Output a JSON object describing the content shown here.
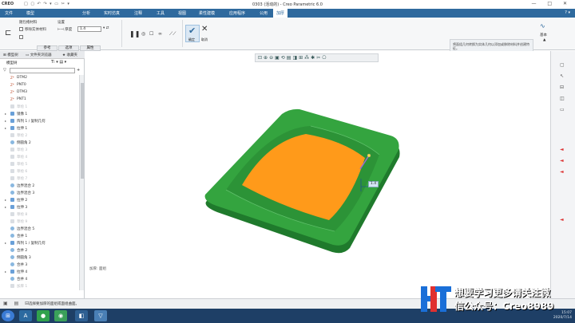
{
  "window": {
    "logo": "CREO",
    "title": "0303 (活动的) - Creo Parametric 6.0",
    "controls": [
      "—",
      "□",
      "✕"
    ]
  },
  "menu": {
    "tabs": [
      "文件",
      "模型",
      "分析",
      "实时仿真",
      "注释",
      "工具",
      "视图",
      "柔性建模",
      "应用程序",
      "公用",
      "加厚"
    ],
    "active": "加厚",
    "file_tab": "文件"
  },
  "ribbon": {
    "group_label": "随包络材料",
    "remove_material": "移除实体材料",
    "thickness_label": "厚度",
    "thickness_value": "1.4",
    "settings_label": "设置",
    "ok_label": "确定",
    "cancel_label": "取消",
    "subtabs": [
      "参考",
      "选项",
      "属性"
    ],
    "message": "将面组几何转换为实体几何以添加或移除材料并创建特征。",
    "message_link": "了解更多...",
    "basic_label": "基本"
  },
  "tree": {
    "tabs": [
      "模型树",
      "文件夹浏览器",
      "收藏夹"
    ],
    "toolbar_label": "模型树",
    "items": [
      {
        "label": "DTM2",
        "kind": "datum",
        "dim": false,
        "expandable": false
      },
      {
        "label": "PNT0",
        "kind": "datum",
        "dim": false,
        "expandable": false
      },
      {
        "label": "DTM3",
        "kind": "datum",
        "dim": false,
        "expandable": false
      },
      {
        "label": "PNT1",
        "kind": "datum",
        "dim": false,
        "expandable": false
      },
      {
        "label": "草绘 1",
        "kind": "dim",
        "dim": true,
        "expandable": false
      },
      {
        "label": "镜像 1",
        "kind": "feat",
        "dim": false,
        "expandable": true
      },
      {
        "label": "阵列 1 / 复制几何",
        "kind": "feat",
        "dim": false,
        "expandable": true
      },
      {
        "label": "拉伸 1",
        "kind": "feat",
        "dim": false,
        "expandable": true
      },
      {
        "label": "草绘 2",
        "kind": "dim",
        "dim": true,
        "expandable": false
      },
      {
        "label": "倒圆角 2",
        "kind": "round",
        "dim": false,
        "expandable": false
      },
      {
        "label": "草绘 3",
        "kind": "dim",
        "dim": true,
        "expandable": false
      },
      {
        "label": "草绘 4",
        "kind": "dim",
        "dim": true,
        "expandable": false
      },
      {
        "label": "草绘 5",
        "kind": "dim",
        "dim": true,
        "expandable": false
      },
      {
        "label": "草绘 6",
        "kind": "dim",
        "dim": true,
        "expandable": false
      },
      {
        "label": "草绘 7",
        "kind": "dim",
        "dim": true,
        "expandable": false
      },
      {
        "label": "边界混合 2",
        "kind": "round",
        "dim": false,
        "expandable": false
      },
      {
        "label": "边界混合 3",
        "kind": "round",
        "dim": false,
        "expandable": false
      },
      {
        "label": "拉伸 2",
        "kind": "feat",
        "dim": false,
        "expandable": true
      },
      {
        "label": "拉伸 3",
        "kind": "feat",
        "dim": false,
        "expandable": true
      },
      {
        "label": "草绘 8",
        "kind": "dim",
        "dim": true,
        "expandable": false
      },
      {
        "label": "草绘 9",
        "kind": "dim",
        "dim": true,
        "expandable": false
      },
      {
        "label": "边界混合 5",
        "kind": "round",
        "dim": false,
        "expandable": false
      },
      {
        "label": "合并 1",
        "kind": "round",
        "dim": false,
        "expandable": false
      },
      {
        "label": "阵列 1 / 复制几何",
        "kind": "feat",
        "dim": false,
        "expandable": true
      },
      {
        "label": "合并 2",
        "kind": "round",
        "dim": false,
        "expandable": false
      },
      {
        "label": "倒圆角 3",
        "kind": "round",
        "dim": false,
        "expandable": false
      },
      {
        "label": "合并 3",
        "kind": "round",
        "dim": false,
        "expandable": false
      },
      {
        "label": "拉伸 4",
        "kind": "feat",
        "dim": false,
        "expandable": true
      },
      {
        "label": "合并 4",
        "kind": "round",
        "dim": false,
        "expandable": false
      },
      {
        "label": "加厚 1",
        "kind": "dim",
        "dim": true,
        "expandable": false
      }
    ]
  },
  "graphics": {
    "dimension_tag": "1.4",
    "model_label": "加厚: 面组"
  },
  "status": {
    "message": "选择要加厚的面组或面组曲面。"
  },
  "clock": {
    "time": "15:07",
    "date": "2020/7/14"
  },
  "watermark": {
    "line1": "想要学习更多请关注微",
    "line2": "信公众号：Creo8989"
  },
  "colors": {
    "menubar": "#2f6a9e",
    "model_green": "#2f9b3a",
    "model_orange": "#ff9a1a",
    "taskbar": "#1e3f66"
  }
}
